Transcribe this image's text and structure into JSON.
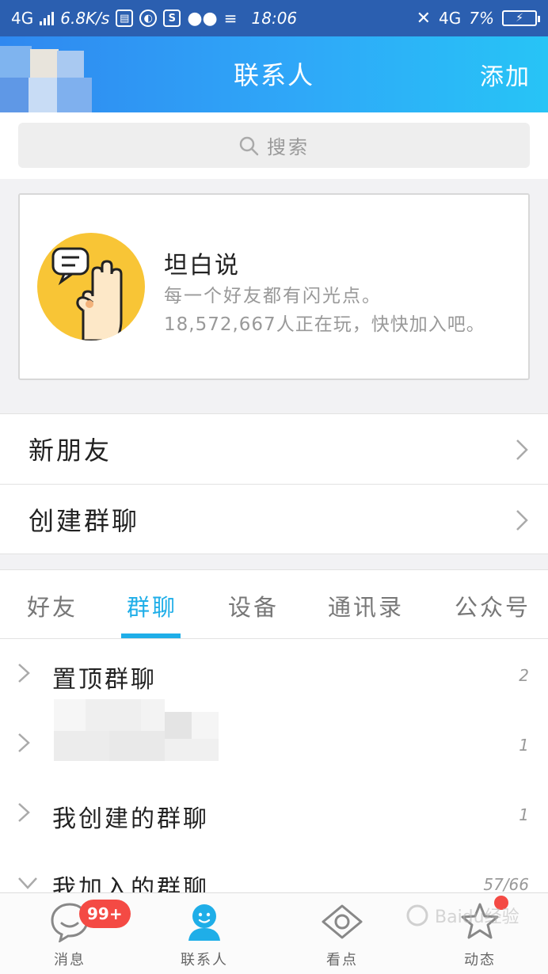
{
  "status_bar": {
    "network": "4G",
    "speed": "6.8K/s",
    "time": "18:06",
    "network_right": "4G",
    "battery": "7%"
  },
  "header": {
    "title": "联系人",
    "add_label": "添加"
  },
  "search": {
    "placeholder": "搜索"
  },
  "promo": {
    "title": "坦白说",
    "subtitle": "每一个好友都有闪光点。",
    "count_text": "18,572,667人正在玩，快快加入吧。"
  },
  "rows": {
    "new_friends": "新朋友",
    "create_group": "创建群聊"
  },
  "tabs": [
    {
      "label": "好友"
    },
    {
      "label": "群聊"
    },
    {
      "label": "设备"
    },
    {
      "label": "通讯录"
    },
    {
      "label": "公众号"
    }
  ],
  "groups": [
    {
      "title": "置顶群聊",
      "count": "2"
    },
    {
      "title": "",
      "count": "1"
    },
    {
      "title": "我创建的群聊",
      "count": "1"
    },
    {
      "title": "我加入的群聊",
      "count": "57/66"
    }
  ],
  "bottom_nav": [
    {
      "label": "消息",
      "badge": "99+"
    },
    {
      "label": "联系人"
    },
    {
      "label": "看点"
    },
    {
      "label": "动态"
    }
  ],
  "watermark": "Baidu经验",
  "colors": {
    "accent": "#1faee8",
    "header_start": "#2f88f0",
    "header_end": "#27c4f6",
    "badge": "#f44a44"
  }
}
